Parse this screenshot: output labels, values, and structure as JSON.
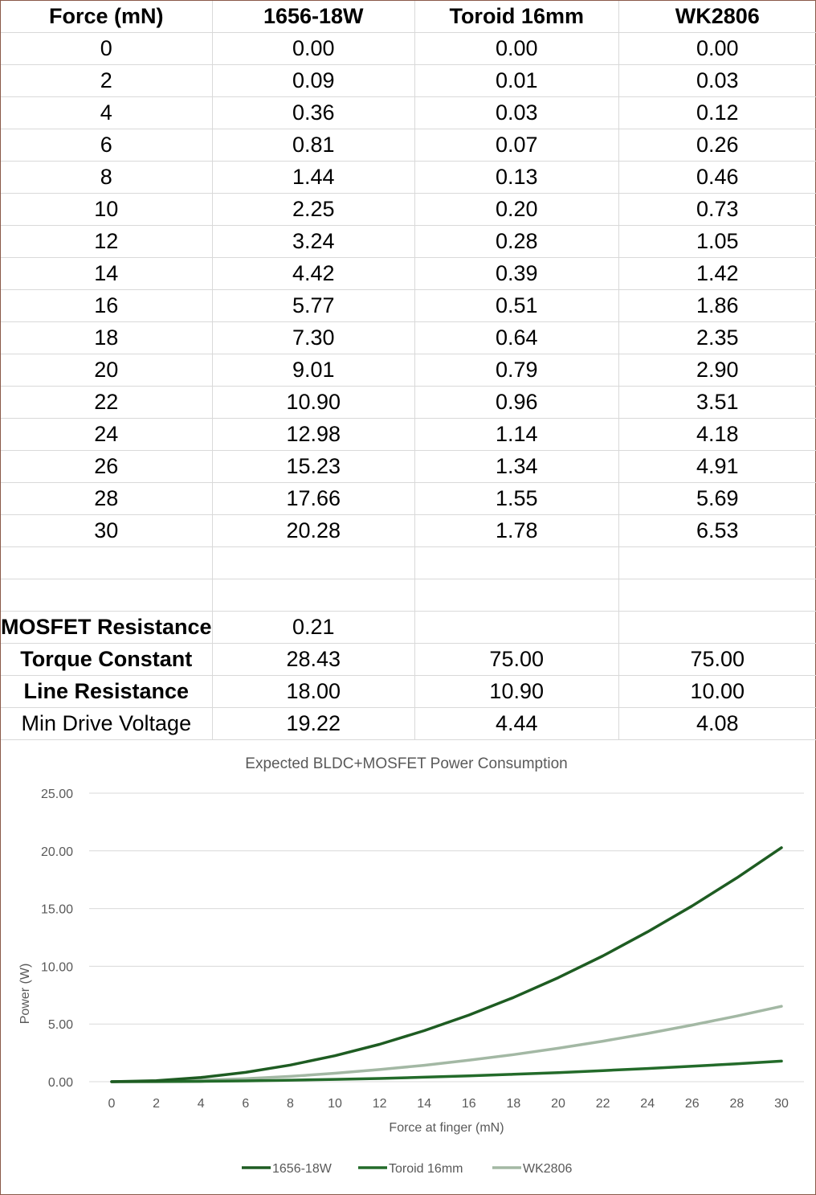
{
  "table": {
    "headers": [
      "Force (mN)",
      "1656-18W",
      "Toroid 16mm",
      "WK2806"
    ],
    "rows": [
      [
        "0",
        "0.00",
        "0.00",
        "0.00"
      ],
      [
        "2",
        "0.09",
        "0.01",
        "0.03"
      ],
      [
        "4",
        "0.36",
        "0.03",
        "0.12"
      ],
      [
        "6",
        "0.81",
        "0.07",
        "0.26"
      ],
      [
        "8",
        "1.44",
        "0.13",
        "0.46"
      ],
      [
        "10",
        "2.25",
        "0.20",
        "0.73"
      ],
      [
        "12",
        "3.24",
        "0.28",
        "1.05"
      ],
      [
        "14",
        "4.42",
        "0.39",
        "1.42"
      ],
      [
        "16",
        "5.77",
        "0.51",
        "1.86"
      ],
      [
        "18",
        "7.30",
        "0.64",
        "2.35"
      ],
      [
        "20",
        "9.01",
        "0.79",
        "2.90"
      ],
      [
        "22",
        "10.90",
        "0.96",
        "3.51"
      ],
      [
        "24",
        "12.98",
        "1.14",
        "4.18"
      ],
      [
        "26",
        "15.23",
        "1.34",
        "4.91"
      ],
      [
        "28",
        "17.66",
        "1.55",
        "5.69"
      ],
      [
        "30",
        "20.28",
        "1.78",
        "6.53"
      ]
    ],
    "params": [
      {
        "label": "MOSFET Resistance",
        "values": [
          "0.21",
          "",
          ""
        ],
        "bold": true
      },
      {
        "label": "Torque Constant",
        "values": [
          "28.43",
          "75.00",
          "75.00"
        ],
        "bold": true
      },
      {
        "label": "Line Resistance",
        "values": [
          "18.00",
          "10.90",
          "10.00"
        ],
        "bold": true
      },
      {
        "label": "Min Drive Voltage",
        "values": [
          "19.22",
          "4.44",
          "4.08"
        ],
        "bold": false
      }
    ]
  },
  "chart_data": {
    "type": "line",
    "title": "Expected BLDC+MOSFET  Power Consumption",
    "xlabel": "Force at finger (mN)",
    "ylabel": "Power (W)",
    "x": [
      0,
      2,
      4,
      6,
      8,
      10,
      12,
      14,
      16,
      18,
      20,
      22,
      24,
      26,
      28,
      30
    ],
    "ylim": [
      0,
      25
    ],
    "yticks": [
      "0.00",
      "5.00",
      "10.00",
      "15.00",
      "20.00",
      "25.00"
    ],
    "xticks": [
      "0",
      "2",
      "4",
      "6",
      "8",
      "10",
      "12",
      "14",
      "16",
      "18",
      "20",
      "22",
      "24",
      "26",
      "28",
      "30"
    ],
    "grid": true,
    "legend": "bottom",
    "series": [
      {
        "name": "1656-18W",
        "color": "#1e5c22",
        "values": [
          0.0,
          0.09,
          0.36,
          0.81,
          1.44,
          2.25,
          3.24,
          4.42,
          5.77,
          7.3,
          9.01,
          10.9,
          12.98,
          15.23,
          17.66,
          20.28
        ]
      },
      {
        "name": "Toroid 16mm",
        "color": "#236b2a",
        "values": [
          0.0,
          0.01,
          0.03,
          0.07,
          0.13,
          0.2,
          0.28,
          0.39,
          0.51,
          0.64,
          0.79,
          0.96,
          1.14,
          1.34,
          1.55,
          1.78
        ]
      },
      {
        "name": "WK2806",
        "color": "#a3b8a4",
        "values": [
          0.0,
          0.03,
          0.12,
          0.26,
          0.46,
          0.73,
          1.05,
          1.42,
          1.86,
          2.35,
          2.9,
          3.51,
          4.18,
          4.91,
          5.69,
          6.53
        ]
      }
    ]
  }
}
